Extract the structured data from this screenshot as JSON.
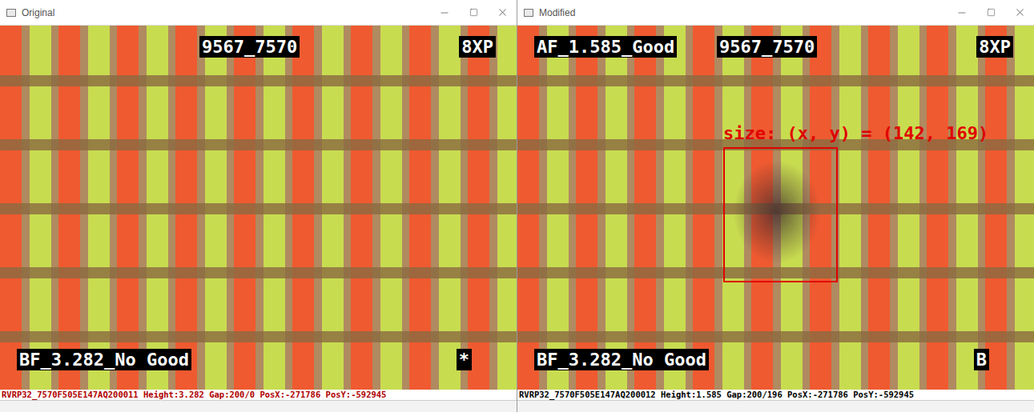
{
  "windows": [
    {
      "title": "Original",
      "id_label": "9567_7570",
      "mode_label": "8XP",
      "bf_label": "BF_3.282_No Good",
      "mark_label": "*",
      "status": {
        "text": "RVRP32_7570F505E147AQ200011 Height:3.282 Gap:200/0 PosX:-271786 PosY:-592945",
        "color": "#b00000"
      }
    },
    {
      "title": "Modified",
      "af_label": "AF_1.585_Good",
      "id_label": "9567_7570",
      "mode_label": "8XP",
      "bf_label": "BF_3.282_No Good",
      "mark_label": "B",
      "detection": {
        "label": "size: (x, y) = (142, 169)"
      },
      "status": {
        "text": "RVRP32_7570F505E147AQ200012 Height:1.585 Gap:200/196 PosX:-271786 PosY:-592945",
        "color": "#000000"
      }
    }
  ]
}
